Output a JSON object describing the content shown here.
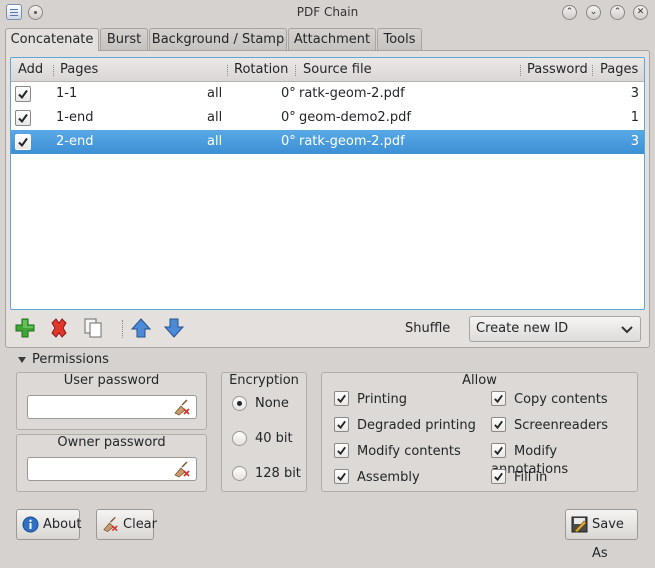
{
  "window": {
    "title": "PDF Chain"
  },
  "tabs": [
    {
      "label": "Concatenate",
      "active": true
    },
    {
      "label": "Burst",
      "active": false
    },
    {
      "label": "Background / Stamp",
      "active": false
    },
    {
      "label": "Attachment",
      "active": false
    },
    {
      "label": "Tools",
      "active": false
    }
  ],
  "table": {
    "columns": {
      "add": "Add",
      "pages": "Pages",
      "rotation": "Rotation",
      "source": "Source file",
      "password": "Password",
      "count": "Pages"
    },
    "rows": [
      {
        "checked": true,
        "pages": "1-1",
        "which": "all",
        "rotation": "0°",
        "source": "ratk-geom-2.pdf",
        "password": "",
        "count": "3",
        "selected": false
      },
      {
        "checked": true,
        "pages": "1-end",
        "which": "all",
        "rotation": "0°",
        "source": "geom-demo2.pdf",
        "password": "",
        "count": "1",
        "selected": false
      },
      {
        "checked": true,
        "pages": "2-end",
        "which": "all",
        "rotation": "0°",
        "source": "ratk-geom-2.pdf",
        "password": "",
        "count": "3",
        "selected": true
      }
    ]
  },
  "toolbar": {
    "icons": [
      "add-icon",
      "remove-icon",
      "copy-icon",
      "move-up-icon",
      "move-down-icon"
    ],
    "shuffle_label": "Shuffle",
    "id_select_value": "Create new ID"
  },
  "permissions": {
    "header": "Permissions",
    "user_password_label": "User password",
    "user_password_value": "",
    "owner_password_label": "Owner password",
    "owner_password_value": "",
    "encryption": {
      "label": "Encryption",
      "options": [
        "None",
        "40 bit",
        "128 bit"
      ],
      "selected": "None"
    },
    "allow": {
      "label": "Allow",
      "items": [
        {
          "label": "Printing",
          "checked": true
        },
        {
          "label": "Degraded printing",
          "checked": true
        },
        {
          "label": "Modify contents",
          "checked": true
        },
        {
          "label": "Assembly",
          "checked": true
        },
        {
          "label": "Copy contents",
          "checked": true
        },
        {
          "label": "Screenreaders",
          "checked": true
        },
        {
          "label": "Modify annotations",
          "checked": true
        },
        {
          "label": "Fill in",
          "checked": true
        }
      ]
    }
  },
  "buttons": {
    "about": "About",
    "clear": "Clear",
    "save_as": "Save As"
  },
  "colors": {
    "selection": "#3c8fd4",
    "focus_border": "#5aa7d8",
    "window_bg": "#d6d2d0"
  }
}
